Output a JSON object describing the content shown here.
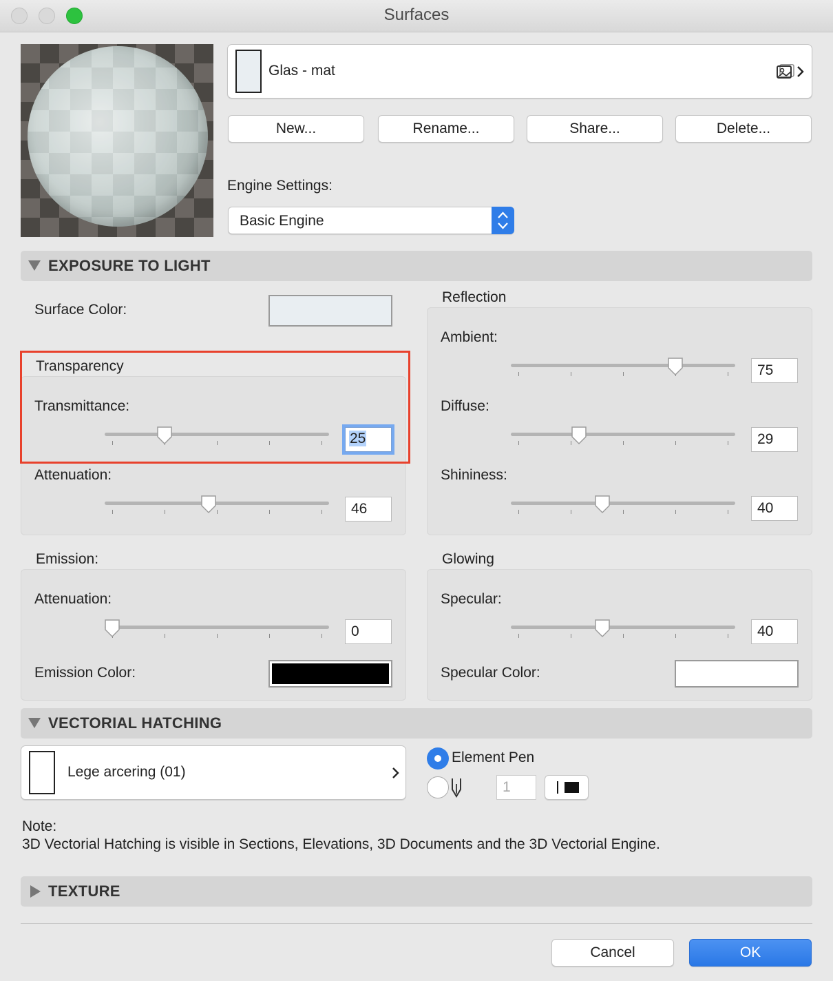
{
  "window": {
    "title": "Surfaces"
  },
  "surface": {
    "name": "Glas - mat"
  },
  "buttons": {
    "new": "New...",
    "rename": "Rename...",
    "share": "Share...",
    "delete": "Delete..."
  },
  "engine": {
    "label": "Engine Settings:",
    "value": "Basic Engine"
  },
  "exposure": {
    "heading": "EXPOSURE TO LIGHT",
    "surface_color_label": "Surface Color:",
    "surface_color": "#e9eef2",
    "transparency": {
      "heading": "Transparency",
      "transmittance_label": "Transmittance:",
      "transmittance": "25",
      "attenuation_label": "Attenuation:",
      "attenuation": "46"
    },
    "reflection": {
      "heading": "Reflection",
      "ambient_label": "Ambient:",
      "ambient": "75",
      "diffuse_label": "Diffuse:",
      "diffuse": "29",
      "shininess_label": "Shininess:",
      "shininess": "40"
    },
    "emission": {
      "heading": "Emission:",
      "attenuation_label": "Attenuation:",
      "attenuation": "0",
      "color_label": "Emission Color:",
      "color": "#000000"
    },
    "glowing": {
      "heading": "Glowing",
      "specular_label": "Specular:",
      "specular": "40",
      "color_label": "Specular Color:",
      "color": "#ffffff"
    }
  },
  "hatching": {
    "heading": "VECTORIAL HATCHING",
    "fill_name": "Lege arcering (01)",
    "element_pen_label": "Element Pen",
    "pen_number": "1",
    "note_title": "Note:",
    "note_text": "3D Vectorial Hatching is visible in Sections, Elevations, 3D Documents and the 3D Vectorial Engine."
  },
  "texture": {
    "heading": "TEXTURE"
  },
  "footer": {
    "cancel": "Cancel",
    "ok": "OK"
  },
  "colors": {
    "accent": "#2f7de8",
    "highlight_border": "#e8412c"
  },
  "icons": [
    "chevron-right-icon",
    "image-icon",
    "pen-icon",
    "line-style-icon",
    "stepper-icon",
    "triangle-down-icon",
    "triangle-right-icon"
  ]
}
